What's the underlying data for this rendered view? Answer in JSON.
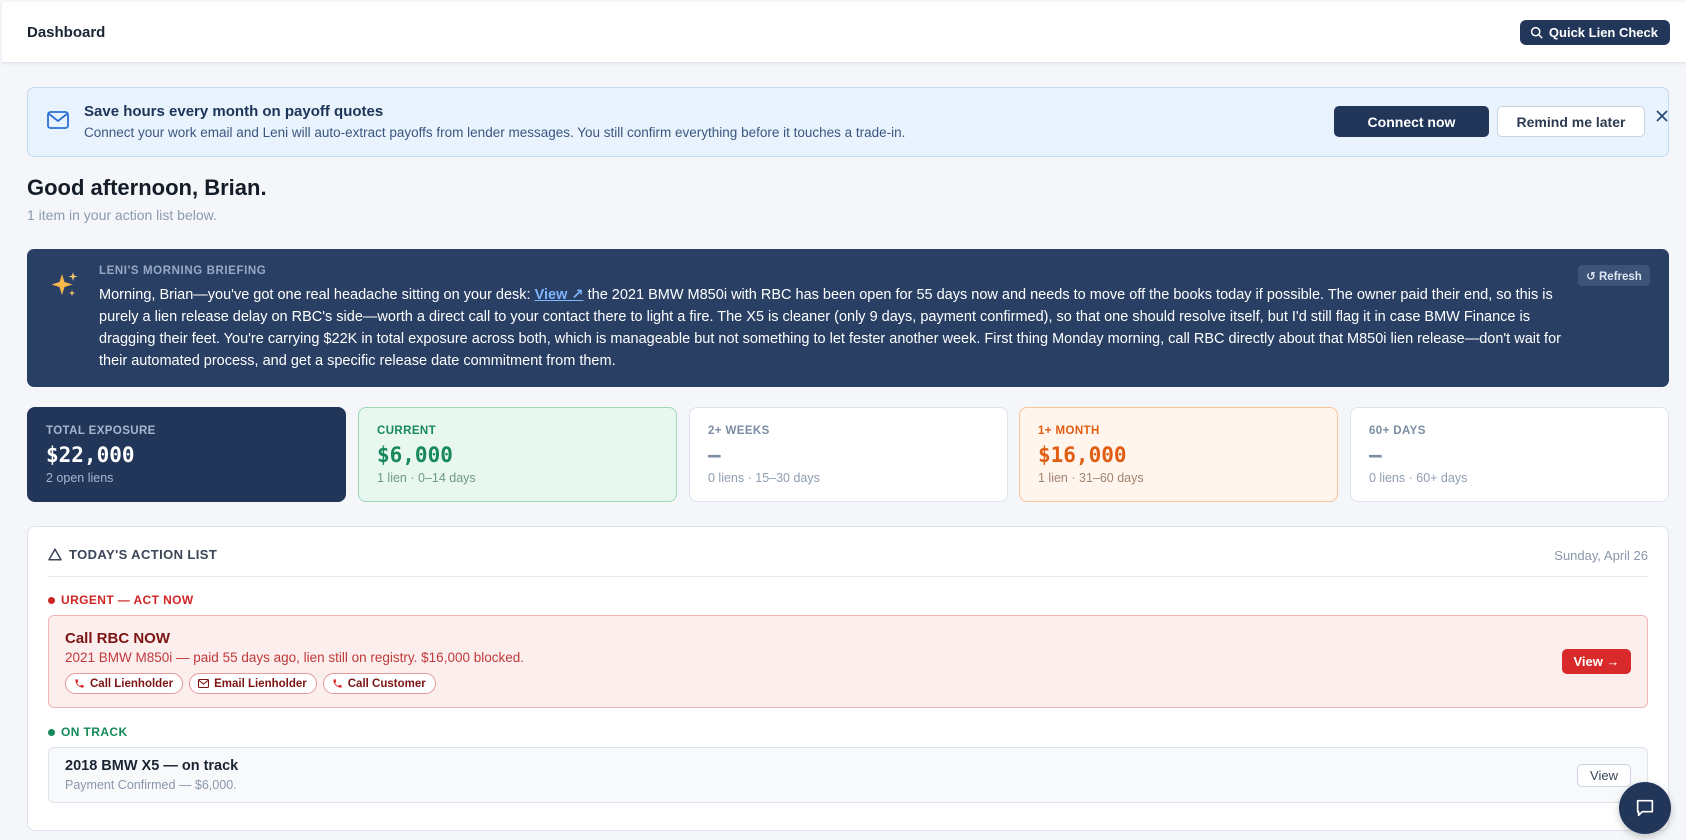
{
  "header": {
    "title": "Dashboard",
    "quick_lien_check_label": "Quick Lien Check",
    "search_icon": "search-icon"
  },
  "banner": {
    "icon": "mail-icon",
    "title": "Save hours every month on payoff quotes",
    "subtitle": "Connect your work email and Leni will auto-extract payoffs from lender messages. You still confirm everything before it touches a trade-in.",
    "connect_label": "Connect now",
    "remind_label": "Remind me later",
    "close_icon": "close-icon"
  },
  "greeting": {
    "title": "Good afternoon, Brian.",
    "subtitle": "1 item in your action list below."
  },
  "briefing": {
    "label": "LENI'S MORNING BRIEFING",
    "refresh_label": "↺ Refresh",
    "text_before": "Morning, Brian—you've got one real headache sitting on your desk: ",
    "link_label": "View ↗",
    "text_after": " the 2021 BMW M850i with RBC has been open for 55 days now and needs to move off the books today if possible. The owner paid their end, so this is purely a lien release delay on RBC's side—worth a direct call to your contact there to light a fire. The X5 is cleaner (only 9 days, payment confirmed), so that one should resolve itself, but I'd still flag it in case BMW Finance is dragging their feet. You're carrying $22K in total exposure across both, which is manageable but not something to let fester another week. First thing Monday morning, call RBC directly about that M850i lien release—don't wait for their automated process, and get a specific release date commitment from them."
  },
  "cards": {
    "total": {
      "label": "TOTAL EXPOSURE",
      "value": "$22,000",
      "sub": "2 open liens"
    },
    "current": {
      "label": "CURRENT",
      "value": "$6,000",
      "sub": "1 lien · 0–14 days"
    },
    "weeks": {
      "label": "2+ WEEKS",
      "value": "—",
      "sub": "0 liens · 15–30 days"
    },
    "month": {
      "label": "1+ MONTH",
      "value": "$16,000",
      "sub": "1 lien · 31–60 days"
    },
    "sixty": {
      "label": "60+ DAYS",
      "value": "—",
      "sub": "0 liens · 60+ days"
    }
  },
  "action_list": {
    "title": "TODAY'S ACTION LIST",
    "date": "Sunday, April 26",
    "urgent_label": "URGENT — ACT NOW",
    "urgent_item": {
      "title": "Call RBC NOW",
      "subtitle": "2021 BMW M850i — paid 55 days ago, lien still on registry. $16,000 blocked.",
      "call_lienholder": "Call Lienholder",
      "email_lienholder": "Email Lienholder",
      "call_customer": "Call Customer",
      "view_label": "View →"
    },
    "track_label": "ON TRACK",
    "track_item": {
      "title": "2018 BMW X5 — on track",
      "subtitle": "Payment Confirmed — $6,000.",
      "view_label": "View"
    }
  },
  "colors": {
    "navy": "#22365a",
    "briefing_bg": "#293f64",
    "urgent_red": "#d82a2a",
    "success_green": "#17895a",
    "warning_orange": "#e05d12"
  }
}
